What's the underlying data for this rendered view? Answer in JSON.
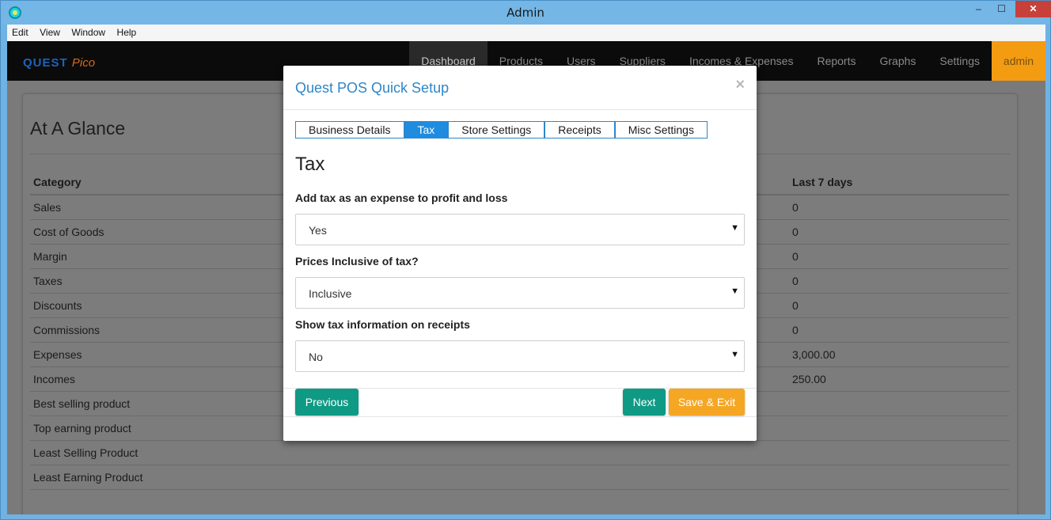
{
  "window": {
    "title": "Admin",
    "minimize": "‒",
    "maximize": "☐",
    "close": "✕"
  },
  "menu": [
    "Edit",
    "View",
    "Window",
    "Help"
  ],
  "header": {
    "brand": "QUEST",
    "brand_suffix": "Pico",
    "nav": [
      "Dashboard",
      "Products",
      "Users",
      "Suppliers",
      "Incomes & Expenses",
      "Reports",
      "Graphs",
      "Settings"
    ],
    "user": "admin"
  },
  "dashboard": {
    "title": "At A Glance",
    "columns": [
      "Category",
      "Last 7 days"
    ],
    "rows": [
      {
        "category": "Sales",
        "last7": "0"
      },
      {
        "category": "Cost of Goods",
        "last7": "0"
      },
      {
        "category": "Margin",
        "last7": "0"
      },
      {
        "category": "Taxes",
        "last7": "0"
      },
      {
        "category": "Discounts",
        "last7": "0"
      },
      {
        "category": "Commissions",
        "last7": "0"
      },
      {
        "category": "Expenses",
        "last7": "3,000.00"
      },
      {
        "category": "Incomes",
        "last7": "250.00"
      },
      {
        "category": "Best selling product",
        "last7": ""
      },
      {
        "category": "Top earning product",
        "last7": ""
      },
      {
        "category": "Least Selling Product",
        "last7": ""
      },
      {
        "category": "Least Earning Product",
        "last7": ""
      }
    ]
  },
  "modal": {
    "title": "Quest POS Quick Setup",
    "close": "×",
    "tabs": [
      "Business Details",
      "Tax",
      "Store Settings",
      "Receipts",
      "Misc Settings"
    ],
    "active_tab": "Tax",
    "section_title": "Tax",
    "fields": [
      {
        "label": "Add tax as an expense to profit and loss",
        "value": "Yes"
      },
      {
        "label": "Prices Inclusive of tax?",
        "value": "Inclusive"
      },
      {
        "label": "Show tax information on receipts",
        "value": "No"
      }
    ],
    "caret": "▼",
    "buttons": {
      "previous": "Previous",
      "next": "Next",
      "save_exit": "Save & Exit"
    }
  },
  "colors": {
    "accent_blue": "#2d86c8",
    "tab_active": "#1f8ce0",
    "teal_button": "#0f9a85",
    "orange_button": "#f5a623",
    "admin_orange": "#f39c12"
  }
}
